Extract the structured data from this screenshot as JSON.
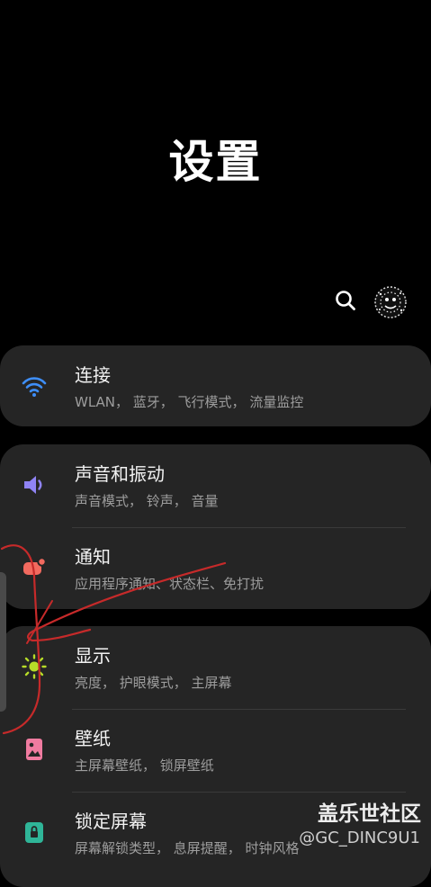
{
  "header": {
    "title": "设置",
    "search_icon": "search-icon",
    "avatar_icon": "avatar-icon"
  },
  "colors": {
    "background": "#000000",
    "card": "#252525",
    "wifi": "#3e8ef7",
    "sound": "#8f83f4",
    "notify": "#f26a5f",
    "display": "#b7dc28",
    "wallpaper": "#f07ba0",
    "lock": "#2fb598",
    "scribble": "#c62a2a"
  },
  "settings": [
    {
      "title": "连接",
      "subtitle": "WLAN， 蓝牙， 飞行模式， 流量监控",
      "icon": "wifi-icon"
    },
    {
      "title": "声音和振动",
      "subtitle": "声音模式， 铃声， 音量",
      "icon": "speaker-icon"
    },
    {
      "title": "通知",
      "subtitle": "应用程序通知、状态栏、免打扰",
      "icon": "notification-badge-icon"
    },
    {
      "title": "显示",
      "subtitle": "亮度， 护眼模式， 主屏幕",
      "icon": "brightness-icon"
    },
    {
      "title": "壁纸",
      "subtitle": "主屏幕壁纸， 锁屏壁纸",
      "icon": "wallpaper-icon"
    },
    {
      "title": "锁定屏幕",
      "subtitle": "屏幕解锁类型， 息屏提醒， 时钟风格",
      "icon": "lock-icon"
    }
  ],
  "watermark": {
    "brand": "盖乐世社区",
    "user": "@GC_DINC9U1"
  }
}
